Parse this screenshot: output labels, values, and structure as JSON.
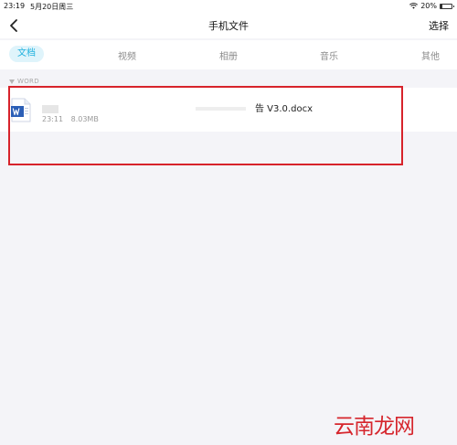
{
  "status_bar": {
    "time": "23:19",
    "date": "5月20日周三",
    "battery_percent": "20%",
    "battery_level": 0.2,
    "icons": [
      "wifi-icon",
      "battery-icon"
    ]
  },
  "nav": {
    "title": "手机文件",
    "action": "选择",
    "back_icon": "chevron-left-icon"
  },
  "tabs": [
    {
      "label": "文档",
      "active": true
    },
    {
      "label": "视频",
      "active": false
    },
    {
      "label": "相册",
      "active": false
    },
    {
      "label": "音乐",
      "active": false
    },
    {
      "label": "其他",
      "active": false
    }
  ],
  "section": {
    "label": "WORD"
  },
  "file": {
    "name_visible": "告 V3.0.docx",
    "time": "23:11",
    "size": "8.03MB",
    "icon": "word-file-icon"
  },
  "colors": {
    "accent": "#20b1de",
    "highlight": "#d7232b",
    "word_blue": "#2b5eb6"
  },
  "watermark": {
    "text": "云南龙网"
  }
}
